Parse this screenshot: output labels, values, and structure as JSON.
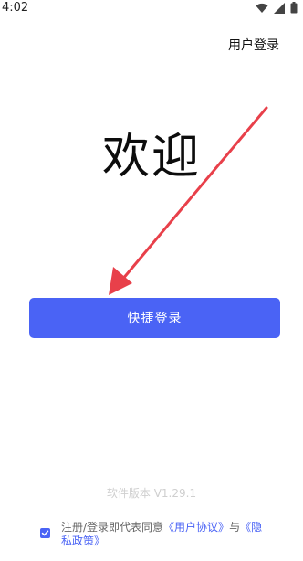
{
  "status_bar": {
    "time": "4:02",
    "icons": [
      "wifi-icon",
      "cellular-signal-icon",
      "battery-icon"
    ]
  },
  "header": {
    "user_login_label": "用户登录"
  },
  "main": {
    "welcome_text": "欢迎",
    "quick_login_label": "快捷登录",
    "version_text": "软件版本 V1.29.1"
  },
  "agreement": {
    "checked": true,
    "prefix": "注册/登录即代表同意",
    "user_agreement_link": "《用户协议》",
    "conjunction": "与",
    "privacy_policy_link": "《隐私政策》"
  },
  "annotation": {
    "arrow_color": "#E8404A",
    "points_to": "quick-login-button"
  },
  "colors": {
    "accent": "#4A63F5",
    "background": "#FFFFFF",
    "version_text": "#CFCFCF"
  }
}
